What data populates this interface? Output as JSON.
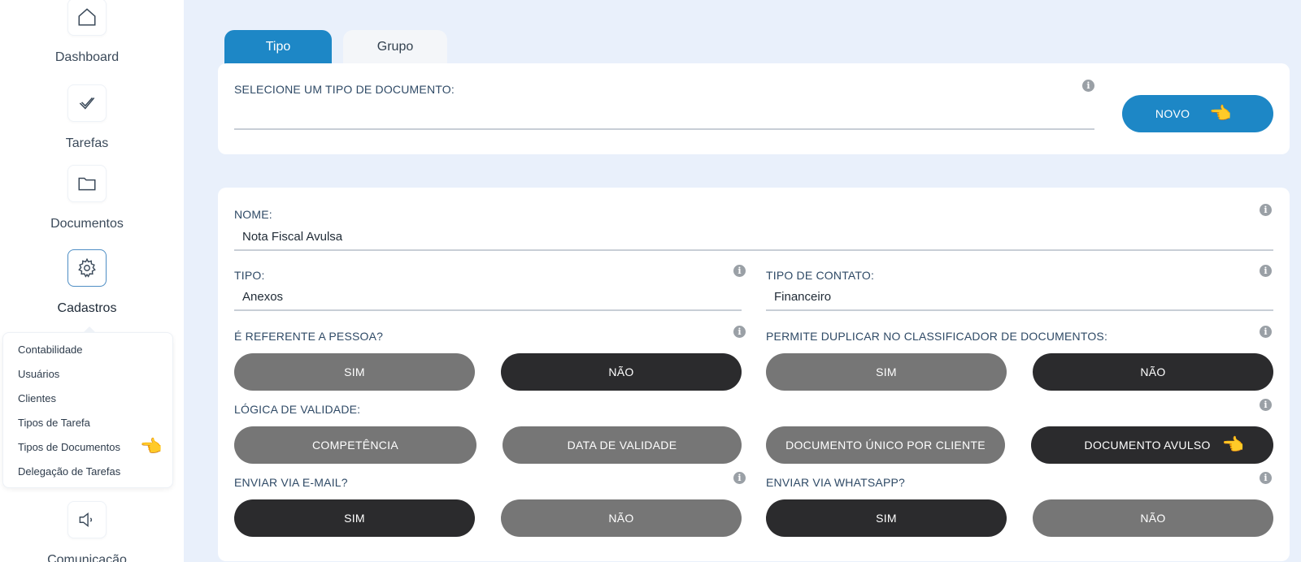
{
  "sidebar": {
    "items": [
      {
        "label": "Dashboard",
        "icon": "home-icon"
      },
      {
        "label": "Tarefas",
        "icon": "check-icon"
      },
      {
        "label": "Documentos",
        "icon": "folder-icon"
      },
      {
        "label": "Cadastros",
        "icon": "gear-icon"
      },
      {
        "label": "Comunicação",
        "icon": "speaker-icon"
      }
    ],
    "submenu": [
      "Contabilidade",
      "Usuários",
      "Clientes",
      "Tipos de Tarefa",
      "Tipos de Documentos",
      "Delegação de Tarefas"
    ]
  },
  "tabs": [
    {
      "label": "Tipo",
      "active": true
    },
    {
      "label": "Grupo",
      "active": false
    }
  ],
  "select_doc": {
    "label": "SELECIONE UM TIPO DE DOCUMENTO:",
    "value": "",
    "new_button": "NOVO"
  },
  "form": {
    "nome": {
      "label": "NOME:",
      "value": "Nota Fiscal Avulsa"
    },
    "tipo": {
      "label": "TIPO:",
      "value": "Anexos"
    },
    "tipo_contato": {
      "label": "TIPO DE CONTATO:",
      "value": "Financeiro"
    },
    "referente_pessoa": {
      "label": "É REFERENTE A PESSOA?",
      "options": [
        "SIM",
        "NÃO"
      ],
      "selected": "NÃO"
    },
    "permite_duplicar": {
      "label": "PERMITE DUPLICAR NO CLASSIFICADOR DE DOCUMENTOS:",
      "options": [
        "SIM",
        "NÃO"
      ],
      "selected": "NÃO"
    },
    "logica_validade": {
      "label": "LÓGICA DE VALIDADE:",
      "options": [
        "COMPETÊNCIA",
        "DATA DE VALIDADE",
        "DOCUMENTO ÚNICO POR CLIENTE",
        "DOCUMENTO AVULSO"
      ],
      "selected": "DOCUMENTO AVULSO"
    },
    "enviar_email": {
      "label": "ENVIAR VIA E-MAIL?",
      "options": [
        "SIM",
        "NÃO"
      ],
      "selected": "SIM"
    },
    "enviar_whatsapp": {
      "label": "ENVIAR VIA WHATSAPP?",
      "options": [
        "SIM",
        "NÃO"
      ],
      "selected": "SIM"
    }
  },
  "colors": {
    "accent": "#1d87c6",
    "selected_button": "#2b2b2d",
    "unselected_button": "#767676",
    "background": "#e9f0fb"
  }
}
